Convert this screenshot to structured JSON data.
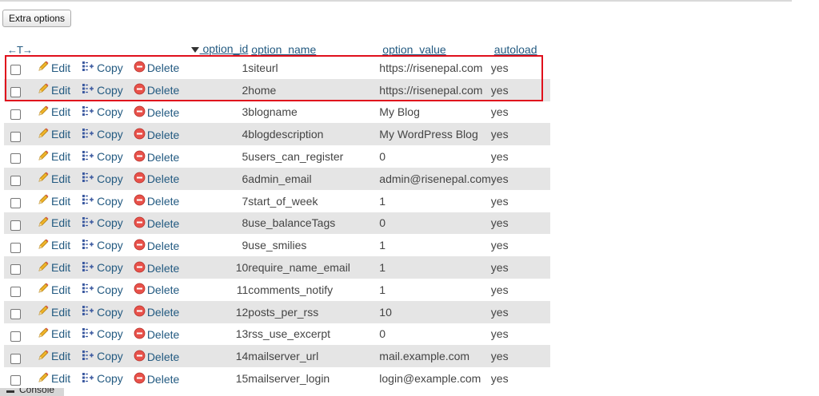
{
  "toolbar": {
    "extra_options_label": "Extra options"
  },
  "table": {
    "arrows_label": "←T→",
    "columns": {
      "option_id": "option_id",
      "option_name": "option_name",
      "option_value": "option_value",
      "autoload": "autoload"
    },
    "sort_icon": "sort-descending-triangle-icon",
    "actions": {
      "edit": "Edit",
      "copy": "Copy",
      "delete": "Delete"
    },
    "action_icons": {
      "edit": "pencil-icon",
      "copy": "copy-icon",
      "delete": "delete-circle-icon"
    },
    "rows": [
      {
        "option_id": "1",
        "option_name": "siteurl",
        "option_value": "https://risenepal.com",
        "autoload": "yes"
      },
      {
        "option_id": "2",
        "option_name": "home",
        "option_value": "https://risenepal.com",
        "autoload": "yes"
      },
      {
        "option_id": "3",
        "option_name": "blogname",
        "option_value": "My Blog",
        "autoload": "yes"
      },
      {
        "option_id": "4",
        "option_name": "blogdescription",
        "option_value": "My WordPress Blog",
        "autoload": "yes"
      },
      {
        "option_id": "5",
        "option_name": "users_can_register",
        "option_value": "0",
        "autoload": "yes"
      },
      {
        "option_id": "6",
        "option_name": "admin_email",
        "option_value": "admin@risenepal.com",
        "autoload": "yes"
      },
      {
        "option_id": "7",
        "option_name": "start_of_week",
        "option_value": "1",
        "autoload": "yes"
      },
      {
        "option_id": "8",
        "option_name": "use_balanceTags",
        "option_value": "0",
        "autoload": "yes"
      },
      {
        "option_id": "9",
        "option_name": "use_smilies",
        "option_value": "1",
        "autoload": "yes"
      },
      {
        "option_id": "10",
        "option_name": "require_name_email",
        "option_value": "1",
        "autoload": "yes"
      },
      {
        "option_id": "11",
        "option_name": "comments_notify",
        "option_value": "1",
        "autoload": "yes"
      },
      {
        "option_id": "12",
        "option_name": "posts_per_rss",
        "option_value": "10",
        "autoload": "yes"
      },
      {
        "option_id": "13",
        "option_name": "rss_use_excerpt",
        "option_value": "0",
        "autoload": "yes"
      },
      {
        "option_id": "14",
        "option_name": "mailserver_url",
        "option_value": "mail.example.com",
        "autoload": "yes"
      },
      {
        "option_id": "15",
        "option_name": "mailserver_login",
        "option_value": "login@example.com",
        "autoload": "yes"
      }
    ]
  },
  "highlight": {
    "color": "#e0101c"
  },
  "console": {
    "label": "Console"
  }
}
